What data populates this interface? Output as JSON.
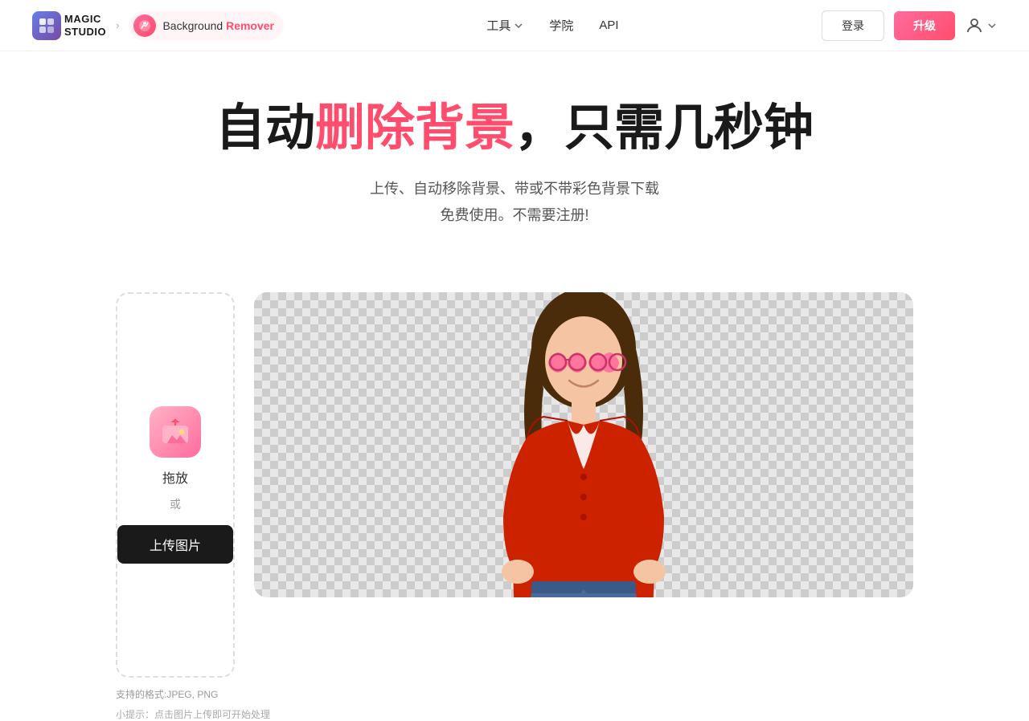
{
  "navbar": {
    "logo_text": "MAGIC\nSTUDIO",
    "arrow": "›",
    "tool_name_prefix": "Background ",
    "tool_name_highlight": "Remover",
    "nav_items": [
      {
        "label": "工具",
        "has_dropdown": true
      },
      {
        "label": "学院",
        "has_dropdown": false
      },
      {
        "label": "API",
        "has_dropdown": false
      }
    ],
    "login_label": "登录",
    "upgrade_label": "升级",
    "user_icon": "👤"
  },
  "hero": {
    "title_prefix": "自动",
    "title_highlight": "删除背景",
    "title_suffix": "，只需几秒钟",
    "subtitle_line1": "上传、自动移除背景、带或不带彩色背景下载",
    "subtitle_line2": "免费使用。不需要注册!"
  },
  "upload": {
    "drag_text": "拖放",
    "or_text": "或",
    "button_label": "上传图片",
    "format_hint": "支持的格式:JPEG, PNG"
  },
  "footer_hint": "小提示：点击图片上传即可开始处理"
}
